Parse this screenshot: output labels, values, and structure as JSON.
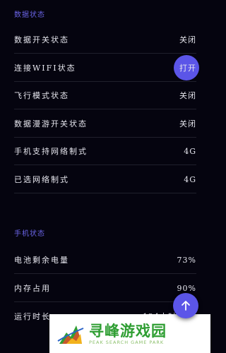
{
  "sections": {
    "data_status_title": "数据状态",
    "phone_status_title": "手机状态"
  },
  "data_status": {
    "rows": [
      {
        "label": "数据开关状态",
        "value": "关闭"
      },
      {
        "label": "连接WIFI状态",
        "value": "打开"
      },
      {
        "label": "飞行模式状态",
        "value": "关闭"
      },
      {
        "label": "数据漫游开关状态",
        "value": "关闭"
      },
      {
        "label": "手机支持网络制式",
        "value": "4G"
      },
      {
        "label": "已选网络制式",
        "value": "4G"
      }
    ]
  },
  "phone_status": {
    "rows": [
      {
        "label": "电池剩余电量",
        "value": "73%"
      },
      {
        "label": "内存占用",
        "value": "90%"
      },
      {
        "label": "运行时长",
        "value": "124小时16分"
      }
    ]
  },
  "fab": {
    "icon": "arrow-up-icon"
  },
  "watermark": {
    "cn": "寻峰游戏园",
    "en": "PEAK SEARCH GAME PARK"
  },
  "colors": {
    "background": "#05040f",
    "accent": "#5b55e8",
    "section_title": "#6a64e6",
    "watermark_green": "#2f9e33"
  }
}
